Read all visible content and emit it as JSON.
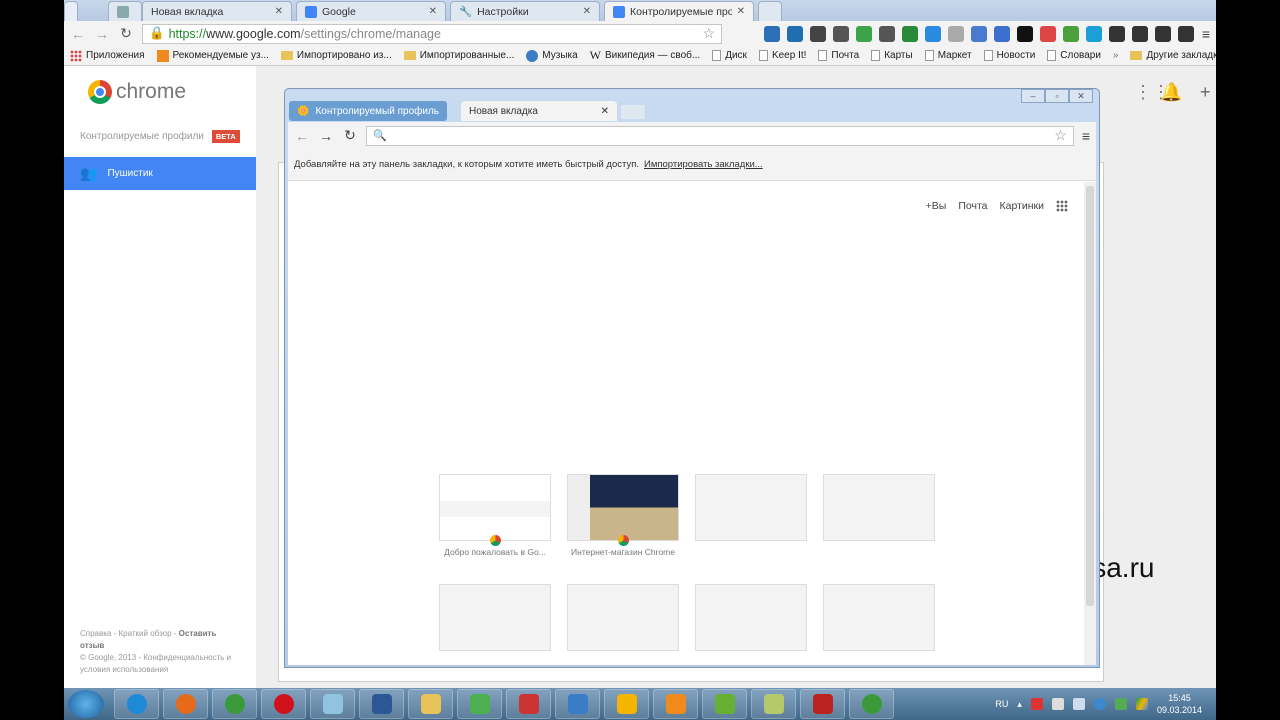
{
  "browser": {
    "tabs": [
      {
        "label": "Новая вкладка",
        "icon": "apps-grid-icon"
      },
      {
        "label": "Google",
        "icon": "google-icon"
      },
      {
        "label": "Настройки",
        "icon": "wrench-icon"
      },
      {
        "label": "Контролируемые профи",
        "icon": "google-icon",
        "active": true
      }
    ],
    "url_scheme": "https://",
    "url_host": "www.google.com",
    "url_path": "/settings/chrome/manage",
    "extension_colors": [
      "#2a6fb8",
      "#1f6fb0",
      "#444",
      "#555",
      "#3ca34a",
      "#555",
      "#2a8a3a",
      "#2a8ae0",
      "#aaa",
      "#4a7acf",
      "#3c6fd0",
      "#111",
      "#d44",
      "#4aa13c",
      "#1c9fd8",
      "#333",
      "#333",
      "#333",
      "#333"
    ],
    "bookmarks": [
      {
        "label": "Приложения",
        "icon": "apps-icon"
      },
      {
        "label": "Рекомендуемые уз...",
        "icon": "suggested-icon"
      },
      {
        "label": "Импортировано из...",
        "icon": "folder-icon"
      },
      {
        "label": "Импортированные...",
        "icon": "folder-icon"
      },
      {
        "label": "Музыка",
        "icon": "music-icon"
      },
      {
        "label": "Википедия — своб...",
        "icon": "wikipedia-icon"
      },
      {
        "label": "Диск",
        "icon": "page-icon"
      },
      {
        "label": "Keep It!",
        "icon": "page-icon"
      },
      {
        "label": "Почта",
        "icon": "page-icon"
      },
      {
        "label": "Карты",
        "icon": "page-icon"
      },
      {
        "label": "Маркет",
        "icon": "page-icon"
      },
      {
        "label": "Новости",
        "icon": "page-icon"
      },
      {
        "label": "Словари",
        "icon": "page-icon"
      }
    ],
    "more": "»",
    "other_bookmarks": "Другие закладки"
  },
  "settings": {
    "logo_text": "chrome",
    "section": "Контролируемые профили",
    "beta": "BETA",
    "profile": "Пушистик",
    "footer": {
      "help": "Справка",
      "sep": " - ",
      "tour": "Краткий обзор",
      "feedback": "Оставить отзыв",
      "copyright": "© Google, 2013 - ",
      "privacy": "Конфиденциальность и условия использования"
    }
  },
  "popup": {
    "profile_badge": "Контролируемый профиль",
    "tab": "Новая вкладка",
    "bookmark_hint": "Добавляйте на эту панель закладки, к которым хотите иметь быстрый доступ.",
    "import_link": "Импортировать закладки...",
    "gbar": {
      "plus": "+Вы",
      "mail": "Почта",
      "images": "Картинки"
    },
    "tiles": [
      {
        "label": "Добро пожаловать в Go..."
      },
      {
        "label": "Интернет-магазин Chrome"
      },
      {
        "label": ""
      },
      {
        "label": ""
      },
      {
        "label": ""
      },
      {
        "label": ""
      },
      {
        "label": ""
      },
      {
        "label": ""
      }
    ]
  },
  "watermark": "vellisa.ru",
  "taskbar": {
    "apps": [
      {
        "icon": "ie-icon",
        "color": "#1e8ad6"
      },
      {
        "icon": "firefox-icon",
        "color": "#e66a1a"
      },
      {
        "icon": "chrome-icon",
        "color": "#3a9a3a"
      },
      {
        "icon": "opera-icon",
        "color": "#d0111b"
      },
      {
        "icon": "window-icon",
        "color": "#8fc3e0"
      },
      {
        "icon": "word-icon",
        "color": "#2b5797"
      },
      {
        "icon": "explorer-icon",
        "color": "#e7c35a"
      },
      {
        "icon": "network-icon",
        "color": "#4caf50"
      },
      {
        "icon": "scissors-icon",
        "color": "#c33"
      },
      {
        "icon": "book-icon",
        "color": "#3b7dc4"
      },
      {
        "icon": "drive-icon",
        "color": "#f4b400"
      },
      {
        "icon": "player-icon",
        "color": "#f08a1c"
      },
      {
        "icon": "utorrent-icon",
        "color": "#66b032"
      },
      {
        "icon": "notes-icon",
        "color": "#b5c86a"
      },
      {
        "icon": "camera-icon",
        "color": "#b22"
      },
      {
        "icon": "chrome-icon",
        "color": "#3a9a3a"
      }
    ],
    "lang": "RU",
    "time": "15:45",
    "date": "09.03.2014"
  }
}
